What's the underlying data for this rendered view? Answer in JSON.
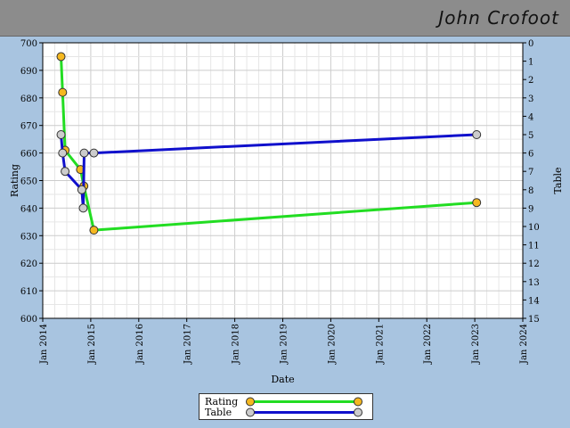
{
  "header": {
    "title": "John Crofoot"
  },
  "colors": {
    "background": "#a8c4e0",
    "header": "#8c8c8c",
    "rating_line": "#22dd22",
    "rating_marker": "#f5b820",
    "table_line": "#1010cc",
    "table_marker": "#cccccc"
  },
  "chart_data": {
    "type": "line",
    "xlabel": "Date",
    "ylabel": "Rating",
    "y2label": "Table",
    "xlim": [
      "2014-01-01",
      "2024-01-01"
    ],
    "ylim": [
      600,
      700
    ],
    "y2lim": [
      0,
      15
    ],
    "y2_inverted": true,
    "grid": true,
    "legend_position": "bottom-center",
    "x_ticks": [
      "Jan 2014",
      "Jan 2015",
      "Jan 2016",
      "Jan 2017",
      "Jan 2018",
      "Jan 2019",
      "Jan 2020",
      "Jan 2021",
      "Jan 2022",
      "Jan 2023",
      "Jan 2024"
    ],
    "y_ticks": [
      "600",
      "610",
      "620",
      "630",
      "640",
      "650",
      "660",
      "670",
      "680",
      "690",
      "700"
    ],
    "y2_ticks": [
      "0",
      "1",
      "2",
      "3",
      "4",
      "5",
      "6",
      "7",
      "8",
      "9",
      "10",
      "11",
      "12",
      "13",
      "14",
      "15"
    ],
    "series": [
      {
        "name": "Rating",
        "axis": "left",
        "points": [
          {
            "x": "2014-05-20",
            "y": 695
          },
          {
            "x": "2014-06-01",
            "y": 682
          },
          {
            "x": "2014-06-20",
            "y": 661
          },
          {
            "x": "2014-10-15",
            "y": 654
          },
          {
            "x": "2014-11-10",
            "y": 648
          },
          {
            "x": "2015-01-25",
            "y": 632
          },
          {
            "x": "2023-01-15",
            "y": 642
          }
        ]
      },
      {
        "name": "Table",
        "axis": "right",
        "points": [
          {
            "x": "2014-05-20",
            "y": 5
          },
          {
            "x": "2014-06-01",
            "y": 6
          },
          {
            "x": "2014-06-20",
            "y": 7
          },
          {
            "x": "2014-10-25",
            "y": 8
          },
          {
            "x": "2014-11-05",
            "y": 9
          },
          {
            "x": "2014-11-12",
            "y": 6
          },
          {
            "x": "2015-01-25",
            "y": 6
          },
          {
            "x": "2023-01-15",
            "y": 5
          }
        ]
      }
    ]
  }
}
